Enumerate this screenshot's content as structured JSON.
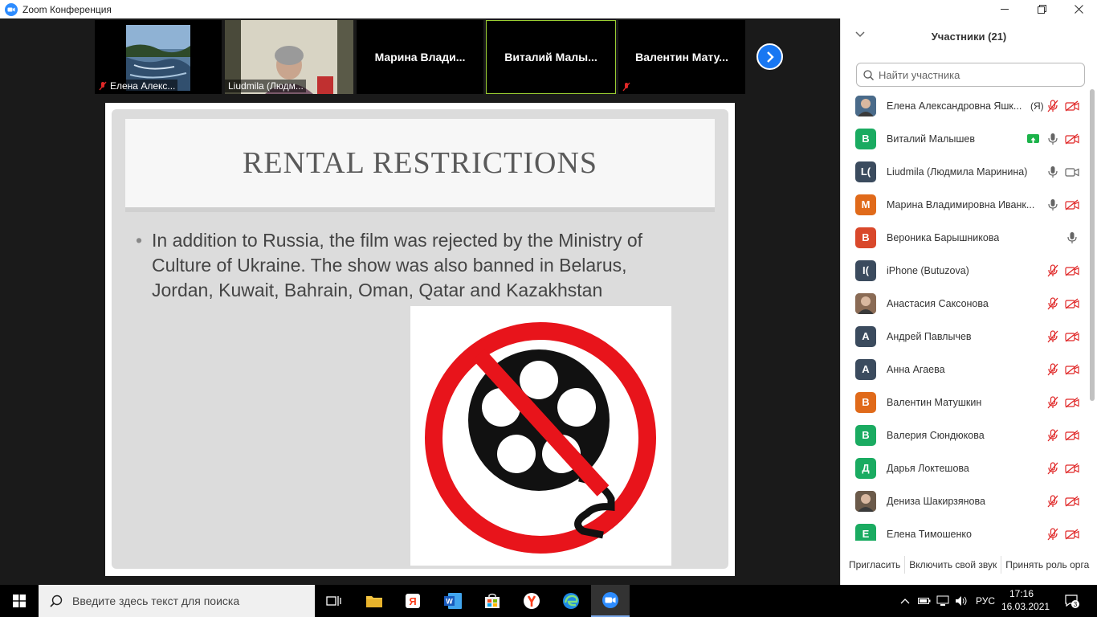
{
  "window": {
    "title": "Zoom Конференция",
    "controls": [
      "minimize",
      "maximize",
      "close"
    ]
  },
  "video_strip": {
    "tiles": [
      {
        "name": "Елена Алекс...",
        "muted": true
      },
      {
        "name": "Liudmila (Людм...",
        "muted": false
      },
      {
        "name": "Марина  Влади..."
      },
      {
        "name": "Виталий  Малы...",
        "active": true
      },
      {
        "name": "Валентин  Мату...",
        "muted": true
      }
    ]
  },
  "slide": {
    "title": "RENTAL RESTRICTIONS",
    "bullet_text": "In addition to Russia, the film was rejected by the Ministry of Culture of Ukraine. The show was also banned in Belarus, Jordan, Kuwait, Bahrain, Oman, Qatar and Kazakhstan",
    "image_icon": "no-film-reel-icon"
  },
  "participants": {
    "header": "Участники (21)",
    "search_placeholder": "Найти участника",
    "list": [
      {
        "name": "Елена Александровна Яшк...",
        "tag": "(Я)",
        "avatar_letter": "",
        "avatar_color": "#4a6b8a",
        "photo": true,
        "mic": "muted",
        "cam": "off"
      },
      {
        "name": "Виталий Малышев",
        "avatar_letter": "В",
        "avatar_color": "#1aab61",
        "share": true,
        "mic": "on",
        "cam": "off"
      },
      {
        "name": "Liudmila (Людмила Маринина)",
        "avatar_letter": "L(",
        "avatar_color": "#3b4b5e",
        "mic": "on",
        "cam": "on"
      },
      {
        "name": "Марина Владимировна Иванк...",
        "avatar_letter": "М",
        "avatar_color": "#e06a1a",
        "mic": "on",
        "cam": "off"
      },
      {
        "name": "Вероника Барышникова",
        "avatar_letter": "В",
        "avatar_color": "#d9482b",
        "mic": "on",
        "cam": "none"
      },
      {
        "name": "iPhone (Butuzova)",
        "avatar_letter": "I(",
        "avatar_color": "#3b4b5e",
        "mic": "muted",
        "cam": "off"
      },
      {
        "name": "Анастасия Саксонова",
        "avatar_letter": "",
        "avatar_color": "#8a6b55",
        "photo": true,
        "mic": "muted",
        "cam": "off"
      },
      {
        "name": "Андрей Павлычев",
        "avatar_letter": "А",
        "avatar_color": "#3b4b5e",
        "mic": "muted",
        "cam": "off"
      },
      {
        "name": "Анна Агаева",
        "avatar_letter": "А",
        "avatar_color": "#3b4b5e",
        "mic": "muted",
        "cam": "off"
      },
      {
        "name": "Валентин Матушкин",
        "avatar_letter": "В",
        "avatar_color": "#e06a1a",
        "mic": "muted",
        "cam": "off"
      },
      {
        "name": "Валерия Сюндюкова",
        "avatar_letter": "В",
        "avatar_color": "#1aab61",
        "mic": "muted",
        "cam": "off"
      },
      {
        "name": "Дарья Локтешова",
        "avatar_letter": "Д",
        "avatar_color": "#1aab61",
        "mic": "muted",
        "cam": "off"
      },
      {
        "name": "Дениза Шакирзянова",
        "avatar_letter": "",
        "avatar_color": "#6b5a4a",
        "photo": true,
        "mic": "muted",
        "cam": "off"
      },
      {
        "name": "Елена Тимошенко",
        "avatar_letter": "Е",
        "avatar_color": "#1aab61",
        "mic": "muted",
        "cam": "off"
      }
    ],
    "footer": {
      "invite": "Пригласить",
      "unmute": "Включить свой звук",
      "claim_host": "Принять роль орга"
    }
  },
  "taskbar": {
    "search_placeholder": "Введите здесь текст для поиска",
    "language": "РУС",
    "time": "17:16",
    "date": "16.03.2021",
    "notifications": "3"
  },
  "colors": {
    "zoom_blue": "#1877f2",
    "muted_red": "#e02828",
    "active_tile_border": "#9acd32"
  }
}
